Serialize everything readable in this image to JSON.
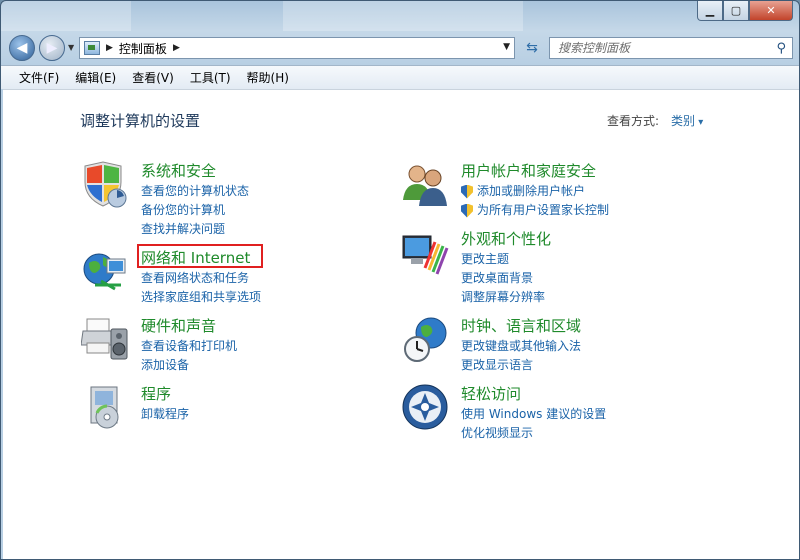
{
  "window": {
    "min_label": "▁",
    "max_label": "▢",
    "close_label": "✕"
  },
  "address": {
    "crumb": "控制面板",
    "sep": "▶"
  },
  "search": {
    "placeholder": "搜索控制面板"
  },
  "menu": [
    "文件(F)",
    "编辑(E)",
    "查看(V)",
    "工具(T)",
    "帮助(H)"
  ],
  "page": {
    "title": "调整计算机的设置",
    "view_by_label": "查看方式:",
    "view_by_value": "类别"
  },
  "categories": {
    "security": {
      "title": "系统和安全",
      "links": [
        "查看您的计算机状态",
        "备份您的计算机",
        "查找并解决问题"
      ],
      "icon": "shield-chart-icon"
    },
    "network": {
      "title": "网络和 Internet",
      "links": [
        "查看网络状态和任务",
        "选择家庭组和共享选项"
      ],
      "icon": "globe-network-icon"
    },
    "hardware": {
      "title": "硬件和声音",
      "links": [
        "查看设备和打印机",
        "添加设备"
      ],
      "icon": "printer-speaker-icon"
    },
    "programs": {
      "title": "程序",
      "links": [
        "卸载程序"
      ],
      "icon": "programs-disc-icon"
    },
    "users": {
      "title": "用户帐户和家庭安全",
      "links": [
        "添加或删除用户帐户",
        "为所有用户设置家长控制"
      ],
      "icon": "users-icon"
    },
    "appearance": {
      "title": "外观和个性化",
      "links": [
        "更改主题",
        "更改桌面背景",
        "调整屏幕分辨率"
      ],
      "icon": "monitor-palette-icon"
    },
    "clock": {
      "title": "时钟、语言和区域",
      "links": [
        "更改键盘或其他输入法",
        "更改显示语言"
      ],
      "icon": "clock-globe-icon"
    },
    "ease": {
      "title": "轻松访问",
      "links": [
        "使用 Windows 建议的设置",
        "优化视频显示"
      ],
      "icon": "ease-of-access-icon"
    }
  },
  "colors": {
    "category_title": "#1f8a2b",
    "link": "#1b63a8",
    "highlight": "#e02020"
  }
}
